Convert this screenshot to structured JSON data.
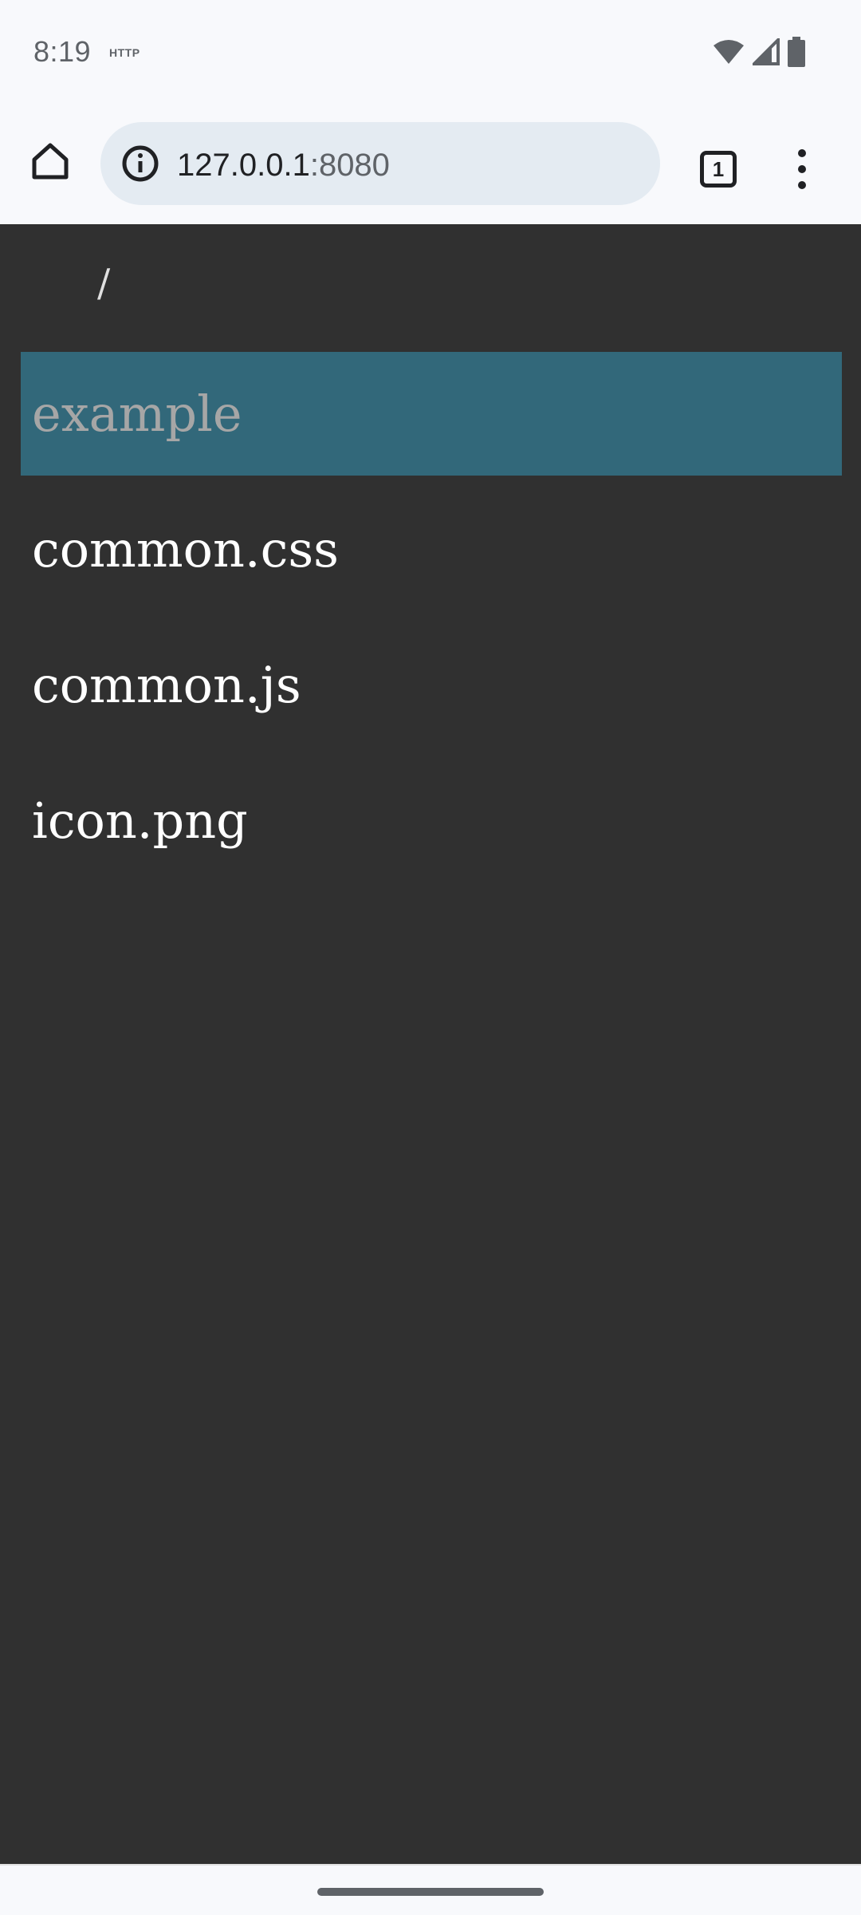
{
  "status_bar": {
    "time": "8:19",
    "http_label": "HTTP",
    "icons": [
      "wifi-icon",
      "signal-icon",
      "battery-icon"
    ]
  },
  "toolbar": {
    "url_host": "127.0.0.1",
    "url_port": ":8080",
    "tab_count": "1",
    "icons": [
      "home-icon",
      "info-icon",
      "tab-switcher-icon",
      "more-vert-icon"
    ]
  },
  "page": {
    "breadcrumb": "/",
    "files": [
      {
        "name": "example",
        "selected": true
      },
      {
        "name": "common.css",
        "selected": false
      },
      {
        "name": "common.js",
        "selected": false
      },
      {
        "name": "icon.png",
        "selected": false
      }
    ],
    "colors": {
      "background": "#303030",
      "selected_background": "#32687a",
      "selected_text": "#a6a6a6",
      "text": "#ffffff"
    }
  }
}
